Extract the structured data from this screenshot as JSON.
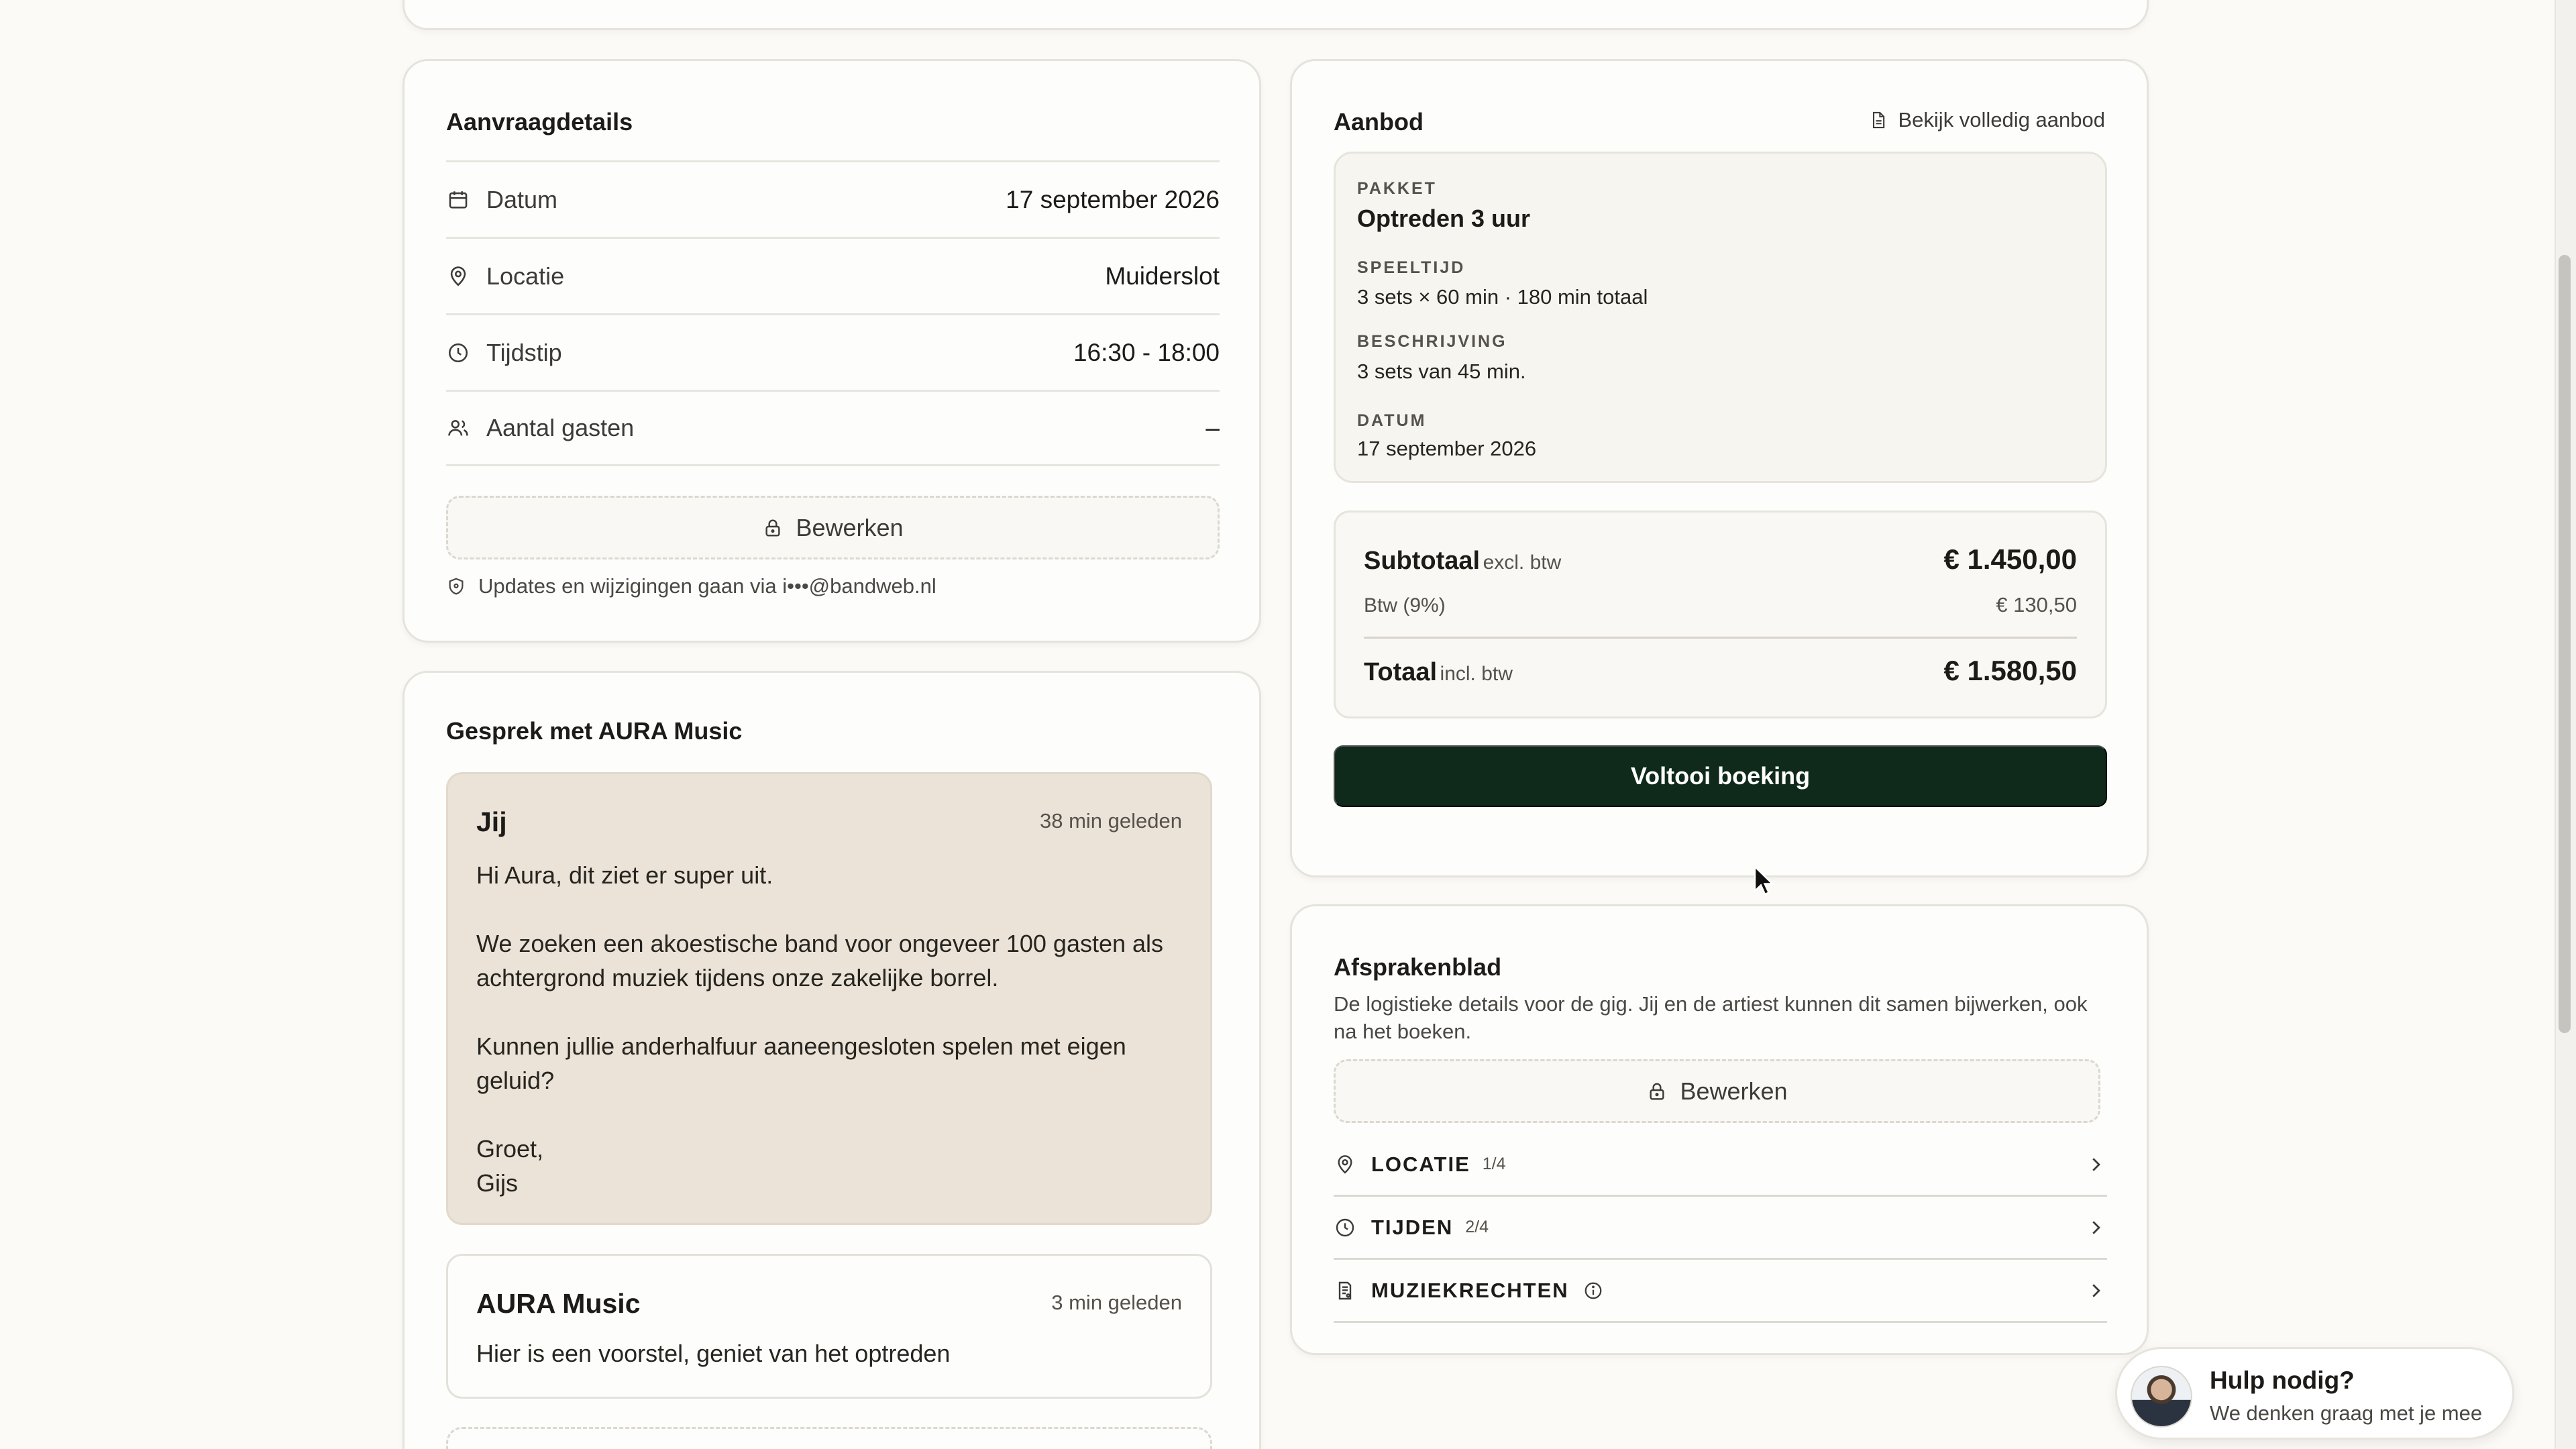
{
  "details": {
    "title": "Aanvraagdetails",
    "rows": [
      {
        "icon": "calendar-icon",
        "label": "Datum",
        "value": "17 september 2026"
      },
      {
        "icon": "location-pin-icon",
        "label": "Locatie",
        "value": "Muiderslot"
      },
      {
        "icon": "clock-icon",
        "label": "Tijdstip",
        "value": "16:30 - 18:00"
      },
      {
        "icon": "users-icon",
        "label": "Aantal gasten",
        "value": "–"
      }
    ],
    "edit_label": "Bewerken",
    "note": "Updates en wijzigingen gaan via i•••@bandweb.nl"
  },
  "offer": {
    "title": "Aanbod",
    "view_link": "Bekijk volledig aanbod",
    "package_label": "PAKKET",
    "package_value": "Optreden 3 uur",
    "playtime_label": "SPEELTIJD",
    "playtime_value": "3 sets × 60 min · 180 min totaal",
    "description_label": "BESCHRIJVING",
    "description_value": "3 sets van 45 min.",
    "date_label": "DATUM",
    "date_value": "17 september 2026",
    "subtotal_label": "Subtotaal",
    "subtotal_suffix": "excl. btw",
    "subtotal_amount": "€ 1.450,00",
    "vat_label": "Btw (9%)",
    "vat_amount": "€ 130,50",
    "total_label": "Totaal",
    "total_suffix": "incl. btw",
    "total_amount": "€ 1.580,50",
    "cta_label": "Voltooi boeking"
  },
  "chat": {
    "title": "Gesprek met AURA Music",
    "messages": [
      {
        "author": "Jij",
        "time": "38 min geleden",
        "paragraphs": [
          "Hi Aura, dit ziet er super uit.",
          "We zoeken een akoestische band voor ongeveer 100 gasten als achtergrond muziek tijdens onze zakelijke borrel.",
          "Kunnen jullie anderhalfuur aaneengesloten spelen met eigen geluid?",
          "Groet,\nGijs"
        ]
      },
      {
        "author": "AURA Music",
        "time": "3 min geleden",
        "paragraphs": [
          "Hier is een voorstel, geniet van het optreden"
        ]
      }
    ]
  },
  "agreements": {
    "title": "Afsprakenblad",
    "description": "De logistieke details voor de gig. Jij en de artiest kunnen dit samen bijwerken, ook na het boeken.",
    "edit_label": "Bewerken",
    "sections": [
      {
        "icon": "location-pin-icon",
        "title": "LOCATIE",
        "count": "1/4"
      },
      {
        "icon": "clock-icon",
        "title": "TIJDEN",
        "count": "2/4"
      },
      {
        "icon": "music-rights-icon",
        "title": "MUZIEKRECHTEN",
        "count": ""
      }
    ]
  },
  "help": {
    "title": "Hulp nodig?",
    "subtitle": "We denken graag met je mee"
  },
  "colors": {
    "background": "#fbfaf7",
    "card": "#fdfdfb",
    "cta": "#0f2a1b",
    "own_message": "#ebe2d8"
  }
}
